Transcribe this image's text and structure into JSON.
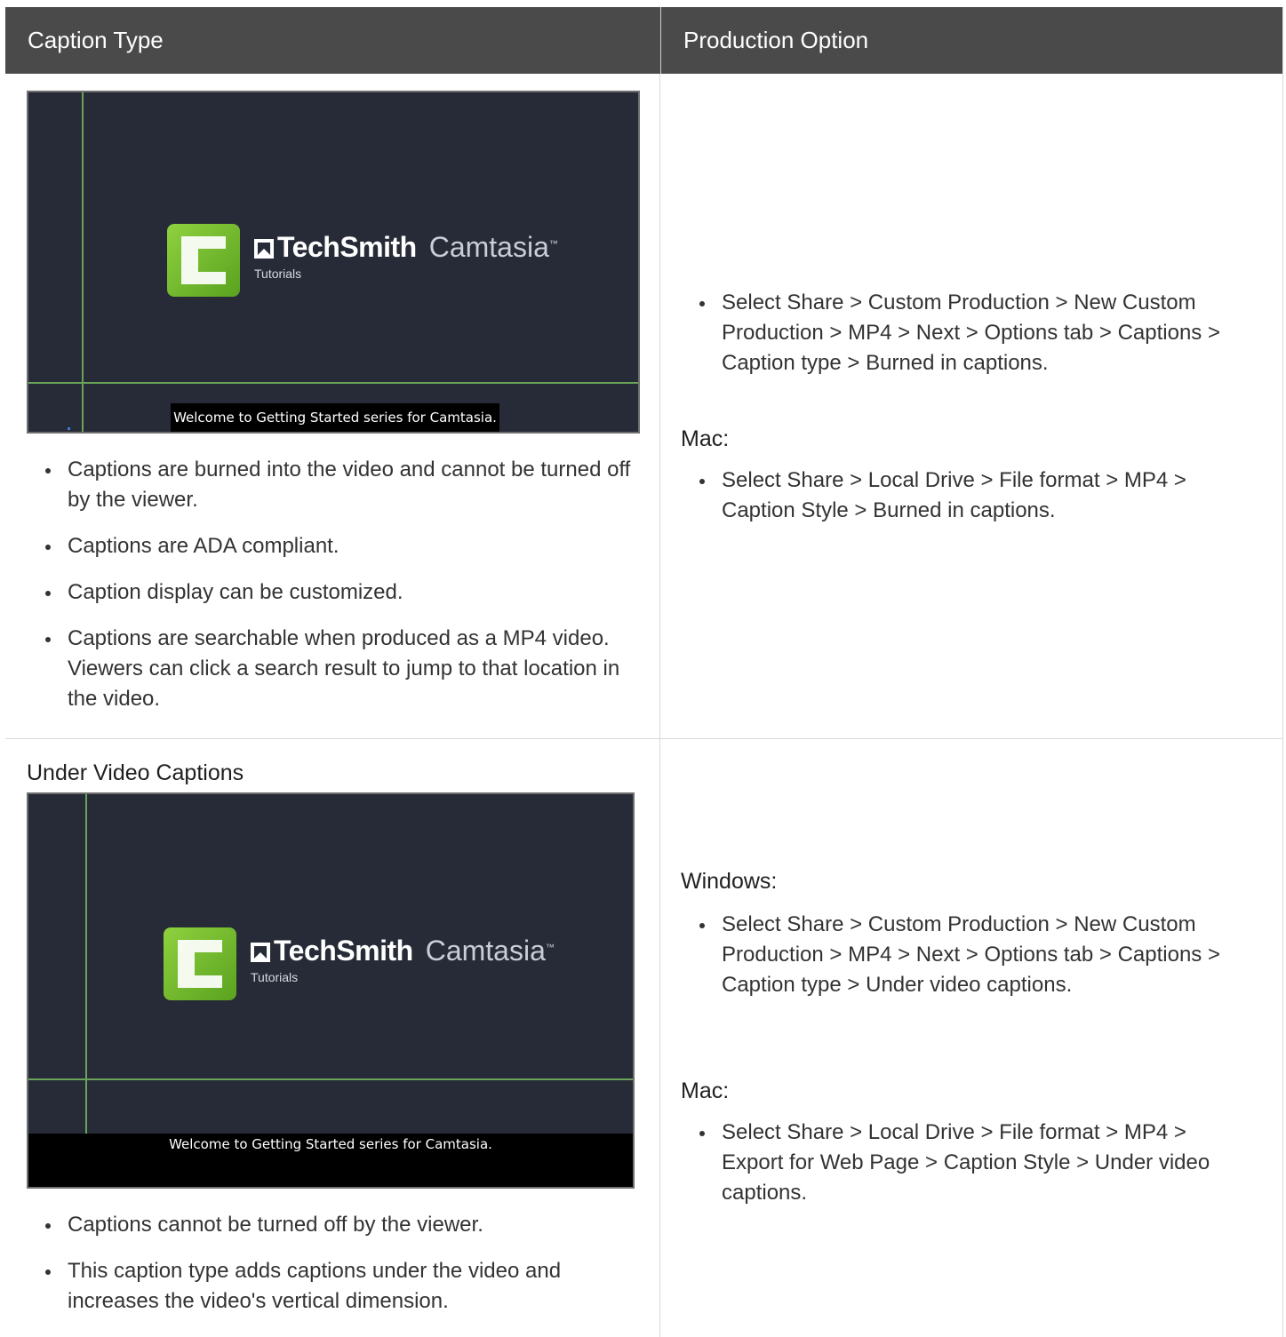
{
  "header": {
    "col1": "Caption Type",
    "col2": "Production Option"
  },
  "row1": {
    "video": {
      "brand_tech": "TechSmith",
      "brand_product": "Camtasia",
      "trademark": "™",
      "brand_sub": "Tutorials",
      "caption": "Welcome to Getting Started series for Camtasia."
    },
    "bullets": [
      "Captions are burned into the video and cannot be turned off by the viewer.",
      "Captions are ADA compliant.",
      "Caption display can be customized.",
      "Captions are searchable when produced as a MP4 video. Viewers can click a search result to jump to that location in the video."
    ],
    "windows_bullets": [
      "Select Share > Custom Production > New Custom Production > MP4 > Next > Options tab > Captions > Caption type > Burned in captions."
    ],
    "mac_label": "Mac:",
    "mac_bullets": [
      "Select Share > Local Drive > File format > MP4 > Caption Style > Burned in captions."
    ]
  },
  "row2": {
    "title": "Under Video Captions",
    "video": {
      "brand_tech": "TechSmith",
      "brand_product": "Camtasia",
      "trademark": "™",
      "brand_sub": "Tutorials",
      "caption": "Welcome to Getting Started series for Camtasia."
    },
    "bullets": [
      "Captions cannot be turned off by the viewer.",
      "This caption type adds captions under the video and increases the video's vertical dimension."
    ],
    "windows_label": "Windows:",
    "windows_bullets": [
      "Select Share > Custom Production > New Custom Production > MP4 > Next > Options tab > Captions > Caption type > Under video captions."
    ],
    "mac_label": "Mac:",
    "mac_bullets": [
      "Select Share > Local Drive > File format > MP4 > Export for Web Page > Caption Style > Under video captions."
    ]
  }
}
